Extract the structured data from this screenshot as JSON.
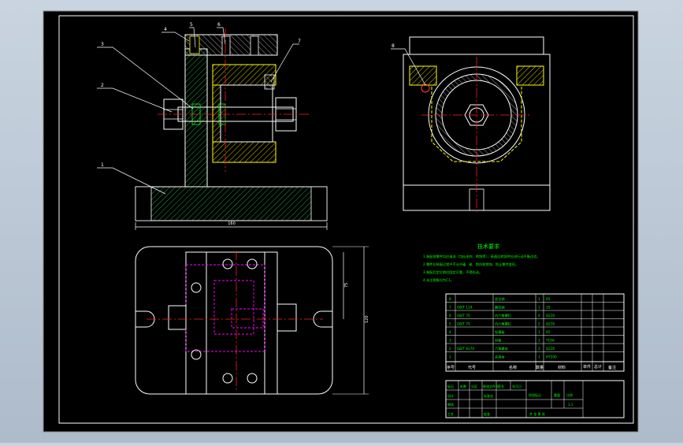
{
  "drawing": {
    "callouts": {
      "c1": "1",
      "c2": "2",
      "c3": "3",
      "c4": "4",
      "c5": "5",
      "c6": "6",
      "c7": "7",
      "c8": "8"
    },
    "dimensions": {
      "overall_width": "160",
      "height_a": "75",
      "height_b": "120"
    },
    "tech_requirements": {
      "title": "技术要求",
      "lines": [
        "1.装配前零件均应清洗（包括毛刺、锈蚀等），高速运转部件应进行动平衡试验。",
        "2.零件在装配过程中不允许磕、碰、划伤和锈蚀，防止零件变形。",
        "3.装配后定位销应固定可靠，不得松动。",
        "4.未注倒角均为C1。"
      ]
    },
    "bom": {
      "headers": {
        "seq": "序号",
        "code": "代号",
        "name": "名称",
        "qty": "数量",
        "material": "材料",
        "unit_wt": "单件",
        "total_wt": "总计",
        "remark": "备注"
      },
      "rows": [
        {
          "seq": "8",
          "code": "",
          "name": "定位销",
          "qty": "1",
          "material": "45"
        },
        {
          "seq": "7",
          "code": "GB/T 119",
          "name": "圆柱销",
          "qty": "1",
          "material": "35"
        },
        {
          "seq": "6",
          "code": "GB/T 70",
          "name": "内六角螺钉",
          "qty": "4",
          "material": "Q235"
        },
        {
          "seq": "5",
          "code": "GB/T 70",
          "name": "内六角螺钉",
          "qty": "2",
          "material": "Q235"
        },
        {
          "seq": "4",
          "code": "",
          "name": "钻模板",
          "qty": "1",
          "material": "45"
        },
        {
          "seq": "3",
          "code": "",
          "name": "衬套",
          "qty": "1",
          "material": "T10A"
        },
        {
          "seq": "2",
          "code": "GB/T 6170",
          "name": "六角螺母",
          "qty": "2",
          "material": "Q235"
        },
        {
          "seq": "1",
          "code": "",
          "name": "夹具体",
          "qty": "1",
          "material": "HT200"
        }
      ]
    },
    "title_block": {
      "labels": [
        "标记",
        "处数",
        "分区",
        "更改文件号",
        "签名",
        "年月日",
        "设计",
        "标准化",
        "审核",
        "工艺",
        "批准"
      ],
      "stage": "阶段标记",
      "weight": "重量",
      "scale": "比例",
      "scale_value": "1:1",
      "sheet": "共  张  第  张"
    }
  },
  "colors": {
    "background": "#000000",
    "frame": "#ffffff",
    "part": "#ffffff",
    "hatch": "#ffff00",
    "centerline": "#ff2020",
    "hidden": "#ff00ff",
    "dimension": "#ffffff",
    "annotation_green": "#00ff00",
    "hatch_green": "#00cc44"
  }
}
